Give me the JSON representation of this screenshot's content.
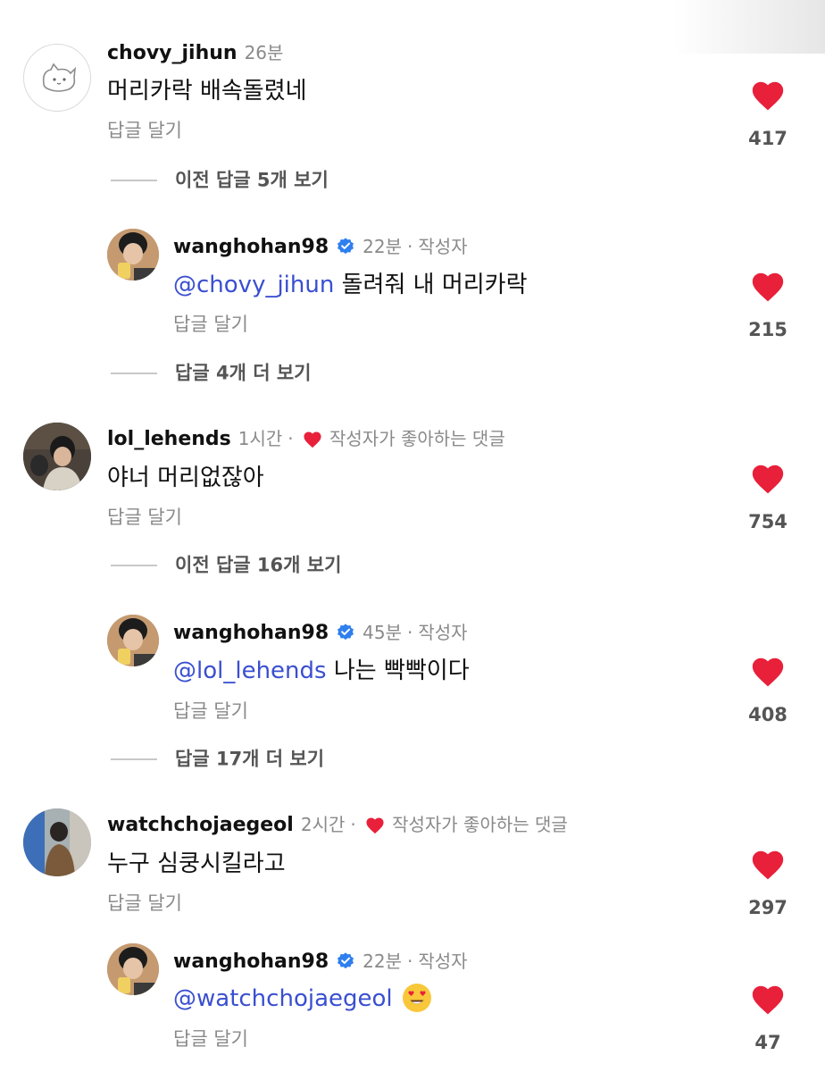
{
  "colors": {
    "heart": "#e8203a",
    "mention": "#3a4fd0",
    "verified": "#2f7fef",
    "meta": "#8a8a8a"
  },
  "icons": {
    "like": "heart-icon",
    "verified": "verified-badge-icon",
    "liked_by_creator": "heart-icon"
  },
  "comment_1": {
    "username": "chovy_jihun",
    "time": "26분",
    "text": "머리카락 배속돌렸네",
    "reply_label": "답글 달기",
    "likes": "417",
    "view_more": "이전 답글 5개 보기",
    "reply": {
      "username": "wanghohan98",
      "time": "22분",
      "creator": "작성자",
      "mention": "@chovy_jihun",
      "text": " 돌려줘 내 머리카락",
      "reply_label": "답글 달기",
      "likes": "215",
      "view_more": "답글 4개 더 보기"
    }
  },
  "comment_2": {
    "username": "lol_lehends",
    "time": "1시간",
    "liked_label": "작성자가 좋아하는 댓글",
    "text": "야너 머리없잖아",
    "reply_label": "답글 달기",
    "likes": "754",
    "view_more": "이전 답글 16개 보기",
    "reply": {
      "username": "wanghohan98",
      "time": "45분",
      "creator": "작성자",
      "mention": "@lol_lehends",
      "text": " 나는 빡빡이다",
      "reply_label": "답글 달기",
      "likes": "408",
      "view_more": "답글 17개 더 보기"
    }
  },
  "comment_3": {
    "username": "watchchojaegeol",
    "time": "2시간",
    "liked_label": "작성자가 좋아하는 댓글",
    "text": "누구 심쿵시킬라고",
    "reply_label": "답글 달기",
    "likes": "297",
    "reply": {
      "username": "wanghohan98",
      "time": "22분",
      "creator": "작성자",
      "mention": "@watchchojaegeol",
      "emoji": "heart-eyes-emoji",
      "reply_label": "답글 달기",
      "likes": "47"
    }
  }
}
